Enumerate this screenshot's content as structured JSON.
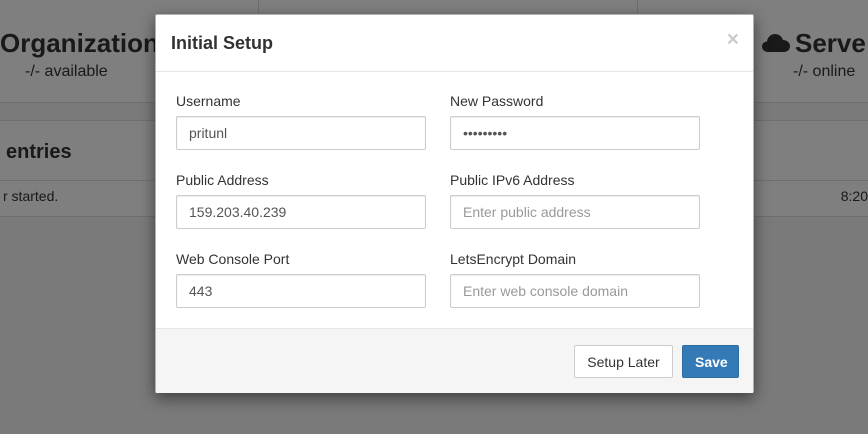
{
  "background": {
    "organizations": {
      "title": "Organization",
      "subtitle": "-/- available"
    },
    "servers": {
      "title": "Serve",
      "subtitle": "-/- online"
    },
    "log": {
      "title": "entries",
      "message": "r started.",
      "time": "8:20"
    }
  },
  "modal": {
    "title": "Initial Setup",
    "close_label": "×",
    "fields": {
      "username": {
        "label": "Username",
        "value": "pritunl",
        "placeholder": ""
      },
      "new_password": {
        "label": "New Password",
        "value": "•••••••••",
        "placeholder": ""
      },
      "public_address": {
        "label": "Public Address",
        "value": "159.203.40.239",
        "placeholder": ""
      },
      "public_ipv6": {
        "label": "Public IPv6 Address",
        "value": "",
        "placeholder": "Enter public address"
      },
      "web_console_port": {
        "label": "Web Console Port",
        "value": "443",
        "placeholder": ""
      },
      "letsencrypt_domain": {
        "label": "LetsEncrypt Domain",
        "value": "",
        "placeholder": "Enter web console domain"
      }
    },
    "buttons": {
      "setup_later": "Setup Later",
      "save": "Save"
    }
  },
  "colors": {
    "primary": "#337ab7",
    "backdrop": "rgba(0,0,0,0.5)"
  }
}
